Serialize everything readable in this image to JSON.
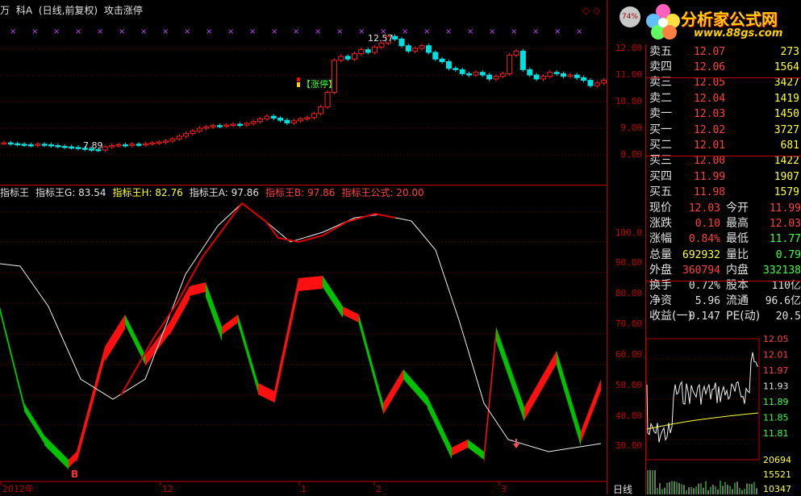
{
  "titlebar": {
    "items": [
      "万",
      "科A",
      "(日线,前复权)",
      "攻击涨停"
    ],
    "right_icons": "◇ ◇"
  },
  "logo": {
    "brand": "分析家公式网",
    "url": "www.88gs.com",
    "badge": "74%"
  },
  "kline": {
    "annot_high": "12.57",
    "annot_low": "7.89",
    "zt_label": "【涨停】",
    "price_axis": [
      "12.00",
      "11.00",
      "10.00",
      "9.00",
      "8.00"
    ]
  },
  "indicator": {
    "header": [
      {
        "text": "指标王",
        "color": "#e0e0e0"
      },
      {
        "text": "指标王G: 83.54",
        "color": "#e0e0e0"
      },
      {
        "text": "指标王H: 82.76",
        "color": "#ffff40"
      },
      {
        "text": "指标王A: 97.86",
        "color": "#e0e0e0"
      },
      {
        "text": "指标王B: 97.86",
        "color": "#ff4040"
      },
      {
        "text": "指标王公式: 20.00",
        "color": "#ff4040"
      }
    ],
    "axis": [
      "100.0",
      "90.00",
      "80.00",
      "70.00",
      "60.00",
      "50.00",
      "40.00",
      "30.00"
    ],
    "mark_b": "B"
  },
  "xaxis": {
    "labels": [
      "2012年",
      "12",
      "1",
      "2",
      "3"
    ],
    "period": "日线"
  },
  "quote": {
    "asks": [
      {
        "name": "卖五",
        "price": "12.07",
        "vol": "273"
      },
      {
        "name": "卖四",
        "price": "12.06",
        "vol": "1564"
      },
      {
        "name": "卖三",
        "price": "12.05",
        "vol": "3427"
      },
      {
        "name": "卖二",
        "price": "12.04",
        "vol": "1419"
      },
      {
        "name": "卖一",
        "price": "12.03",
        "vol": "1450"
      }
    ],
    "bids": [
      {
        "name": "买一",
        "price": "12.02",
        "vol": "3727"
      },
      {
        "name": "买二",
        "price": "12.01",
        "vol": "681"
      },
      {
        "name": "买三",
        "price": "12.00",
        "vol": "1422"
      },
      {
        "name": "买四",
        "price": "11.99",
        "vol": "1907"
      },
      {
        "name": "买五",
        "price": "11.98",
        "vol": "1579"
      }
    ],
    "stats": [
      {
        "l1": "现价",
        "v1": "12.03",
        "c1": "#ff4040",
        "l2": "今开",
        "v2": "11.99",
        "c2": "#ff4040"
      },
      {
        "l1": "涨跌",
        "v1": "0.10",
        "c1": "#ff4040",
        "l2": "最高",
        "v2": "12.03",
        "c2": "#ff4040"
      },
      {
        "l1": "涨幅",
        "v1": "0.84%",
        "c1": "#ff4040",
        "l2": "最低",
        "v2": "11.77",
        "c2": "#40ff40"
      },
      {
        "l1": "总量",
        "v1": "692932",
        "c1": "#ffff40",
        "l2": "量比",
        "v2": "0.79",
        "c2": "#40ff40"
      },
      {
        "l1": "外盘",
        "v1": "360794",
        "c1": "#ff4040",
        "l2": "内盘",
        "v2": "332138",
        "c2": "#40ff40"
      },
      {
        "l1": "换手",
        "v1": "0.72%",
        "c1": "#e0e0e0",
        "l2": "股本",
        "v2": "110亿",
        "c2": "#e0e0e0"
      },
      {
        "l1": "净资",
        "v1": "5.96",
        "c1": "#e0e0e0",
        "l2": "流通",
        "v2": "96.6亿",
        "c2": "#e0e0e0"
      },
      {
        "l1": "收益(一)",
        "v1": "0.147",
        "c1": "#e0e0e0",
        "l2": "PE(动)",
        "v2": "20.5",
        "c2": "#e0e0e0"
      }
    ]
  },
  "mini": {
    "axis": [
      "12.05",
      "12.01",
      "11.97",
      "11.93",
      "11.89",
      "11.85",
      "11.81"
    ],
    "vol_axis": [
      "20694",
      "15521",
      "10347"
    ]
  },
  "colors": {
    "up": "#ff2020",
    "down": "#00e0e0",
    "green": "#00c000",
    "red": "#e00000",
    "grid": "#800000"
  }
}
